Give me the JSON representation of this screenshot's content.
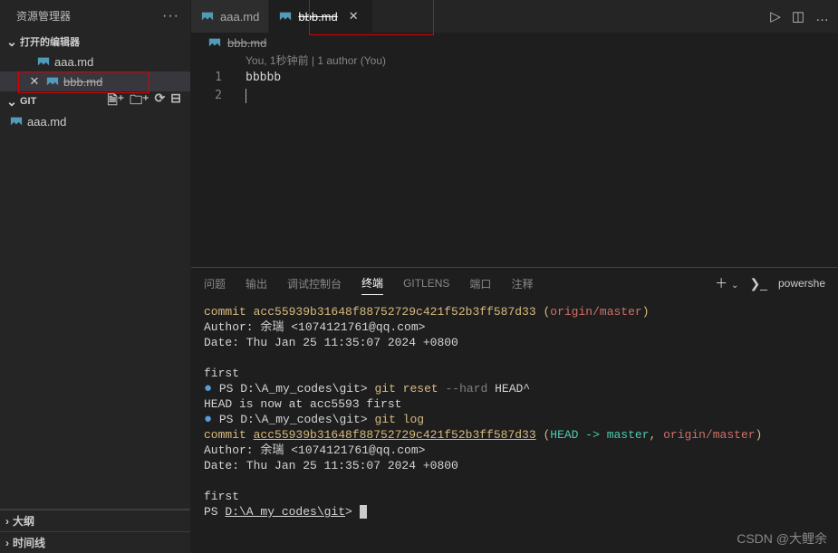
{
  "sidebar": {
    "explorer_title": "资源管理器",
    "open_editors_title": "打开的编辑器",
    "git_title": "GIT",
    "files": {
      "aaa": "aaa.md",
      "bbb": "bbb.md"
    },
    "git_files": {
      "aaa": "aaa.md"
    },
    "outline_title": "大纲",
    "timeline_title": "时间线"
  },
  "tabs": {
    "aaa": "aaa.md",
    "bbb": "bbb.md"
  },
  "breadcrumb": {
    "file": "bbb.md"
  },
  "editor": {
    "codelens": "You, 1秒钟前 | 1 author (You)",
    "line1_num": "1",
    "line2_num": "2",
    "line1_content": "bbbbb"
  },
  "panel": {
    "tabs": {
      "problems": "问题",
      "output": "输出",
      "debug": "调试控制台",
      "terminal": "终端",
      "gitlens": "GITLENS",
      "ports": "端口",
      "comments": "注释"
    },
    "shell": "powershe"
  },
  "terminal": {
    "commit_label": "commit ",
    "hash": "acc55939b31648f88752729c421f52b3ff587d33",
    "origin_master": "origin/master",
    "head_arrow": "HEAD -> ",
    "master": "master",
    "author_line": "Author: 余瑞 <1074121761@qq.com>",
    "date_line": "Date:   Thu Jan 25 11:35:07 2024 +0800",
    "msg_first": "    first",
    "prompt_prefix": "PS ",
    "prompt_path": "D:\\A_my_codes\\git",
    "prompt_gt": "> ",
    "cmd_reset": "git reset ",
    "cmd_reset_arg": "--hard",
    "cmd_reset_tail": " HEAD^",
    "reset_result": "HEAD is now at acc5593 first",
    "cmd_log": "git log"
  },
  "watermark": "CSDN @大鲤余"
}
